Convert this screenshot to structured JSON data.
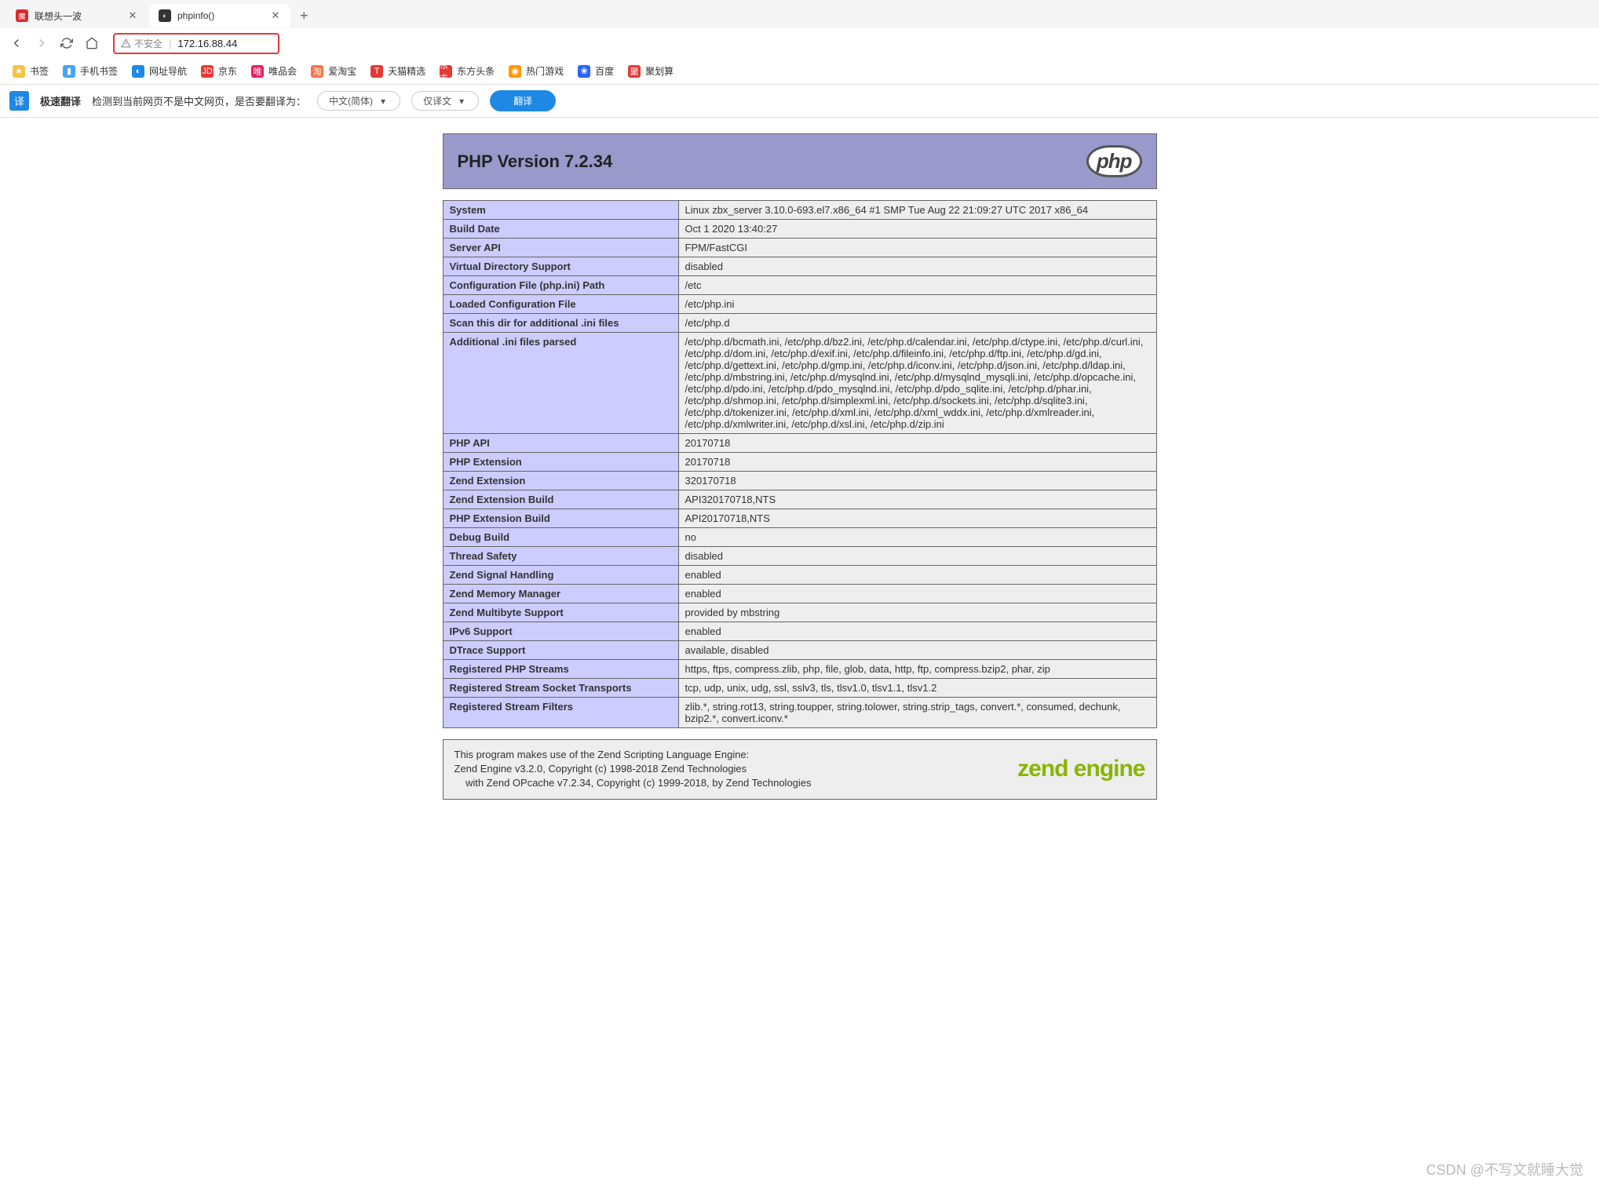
{
  "tabs": [
    {
      "title": "联想头一波",
      "icon_bg": "#d32f2f",
      "icon_text": "魔",
      "active": false
    },
    {
      "title": "phpinfo()",
      "icon_bg": "#333",
      "icon_text": "◐",
      "active": true
    }
  ],
  "nav": {
    "insecure_label": "不安全",
    "address": "172.16.88.44"
  },
  "bookmarks": [
    {
      "label": "书签",
      "icon": "★",
      "bg": "#f6c342"
    },
    {
      "label": "手机书签",
      "icon": "▮",
      "bg": "#42a5f5"
    },
    {
      "label": "网址导航",
      "icon": "◐",
      "bg": "#1e88e5"
    },
    {
      "label": "京东",
      "icon": "JD",
      "bg": "#e53935"
    },
    {
      "label": "唯品会",
      "icon": "唯",
      "bg": "#e91e63"
    },
    {
      "label": "爱淘宝",
      "icon": "淘",
      "bg": "#ff7043"
    },
    {
      "label": "天猫精选",
      "icon": "T",
      "bg": "#e53935"
    },
    {
      "label": "东方头条",
      "icon": "东方",
      "bg": "#e53935"
    },
    {
      "label": "热门游戏",
      "icon": "◉",
      "bg": "#ff9800"
    },
    {
      "label": "百度",
      "icon": "❀",
      "bg": "#2962ff"
    },
    {
      "label": "聚划算",
      "icon": "聚",
      "bg": "#e53935"
    }
  ],
  "translate": {
    "badge": "译",
    "title": "极速翻译",
    "prompt": "检测到当前网页不是中文网页，是否要翻译为：",
    "lang": "中文(简体)",
    "mode": "仅译文",
    "button": "翻译"
  },
  "php": {
    "header": "PHP Version 7.2.34",
    "logo_text": "php",
    "rows": [
      {
        "k": "System",
        "v": "Linux zbx_server 3.10.0-693.el7.x86_64 #1 SMP Tue Aug 22 21:09:27 UTC 2017 x86_64"
      },
      {
        "k": "Build Date",
        "v": "Oct 1 2020 13:40:27"
      },
      {
        "k": "Server API",
        "v": "FPM/FastCGI"
      },
      {
        "k": "Virtual Directory Support",
        "v": "disabled"
      },
      {
        "k": "Configuration File (php.ini) Path",
        "v": "/etc"
      },
      {
        "k": "Loaded Configuration File",
        "v": "/etc/php.ini"
      },
      {
        "k": "Scan this dir for additional .ini files",
        "v": "/etc/php.d"
      },
      {
        "k": "Additional .ini files parsed",
        "v": "/etc/php.d/bcmath.ini, /etc/php.d/bz2.ini, /etc/php.d/calendar.ini, /etc/php.d/ctype.ini, /etc/php.d/curl.ini, /etc/php.d/dom.ini, /etc/php.d/exif.ini, /etc/php.d/fileinfo.ini, /etc/php.d/ftp.ini, /etc/php.d/gd.ini, /etc/php.d/gettext.ini, /etc/php.d/gmp.ini, /etc/php.d/iconv.ini, /etc/php.d/json.ini, /etc/php.d/ldap.ini, /etc/php.d/mbstring.ini, /etc/php.d/mysqlnd.ini, /etc/php.d/mysqlnd_mysqli.ini, /etc/php.d/opcache.ini, /etc/php.d/pdo.ini, /etc/php.d/pdo_mysqlnd.ini, /etc/php.d/pdo_sqlite.ini, /etc/php.d/phar.ini, /etc/php.d/shmop.ini, /etc/php.d/simplexml.ini, /etc/php.d/sockets.ini, /etc/php.d/sqlite3.ini, /etc/php.d/tokenizer.ini, /etc/php.d/xml.ini, /etc/php.d/xml_wddx.ini, /etc/php.d/xmlreader.ini, /etc/php.d/xmlwriter.ini, /etc/php.d/xsl.ini, /etc/php.d/zip.ini"
      },
      {
        "k": "PHP API",
        "v": "20170718"
      },
      {
        "k": "PHP Extension",
        "v": "20170718"
      },
      {
        "k": "Zend Extension",
        "v": "320170718"
      },
      {
        "k": "Zend Extension Build",
        "v": "API320170718,NTS"
      },
      {
        "k": "PHP Extension Build",
        "v": "API20170718,NTS"
      },
      {
        "k": "Debug Build",
        "v": "no"
      },
      {
        "k": "Thread Safety",
        "v": "disabled"
      },
      {
        "k": "Zend Signal Handling",
        "v": "enabled"
      },
      {
        "k": "Zend Memory Manager",
        "v": "enabled"
      },
      {
        "k": "Zend Multibyte Support",
        "v": "provided by mbstring"
      },
      {
        "k": "IPv6 Support",
        "v": "enabled"
      },
      {
        "k": "DTrace Support",
        "v": "available, disabled"
      },
      {
        "k": "Registered PHP Streams",
        "v": "https, ftps, compress.zlib, php, file, glob, data, http, ftp, compress.bzip2, phar, zip"
      },
      {
        "k": "Registered Stream Socket Transports",
        "v": "tcp, udp, unix, udg, ssl, sslv3, tls, tlsv1.0, tlsv1.1, tlsv1.2"
      },
      {
        "k": "Registered Stream Filters",
        "v": "zlib.*, string.rot13, string.toupper, string.tolower, string.strip_tags, convert.*, consumed, dechunk, bzip2.*, convert.iconv.*"
      }
    ],
    "zend": {
      "line1": "This program makes use of the Zend Scripting Language Engine:",
      "line2": "Zend Engine v3.2.0, Copyright (c) 1998-2018 Zend Technologies",
      "line3": "    with Zend OPcache v7.2.34, Copyright (c) 1999-2018, by Zend Technologies",
      "logo": "zend engine"
    }
  },
  "watermark": "CSDN @不写文就睡大觉"
}
